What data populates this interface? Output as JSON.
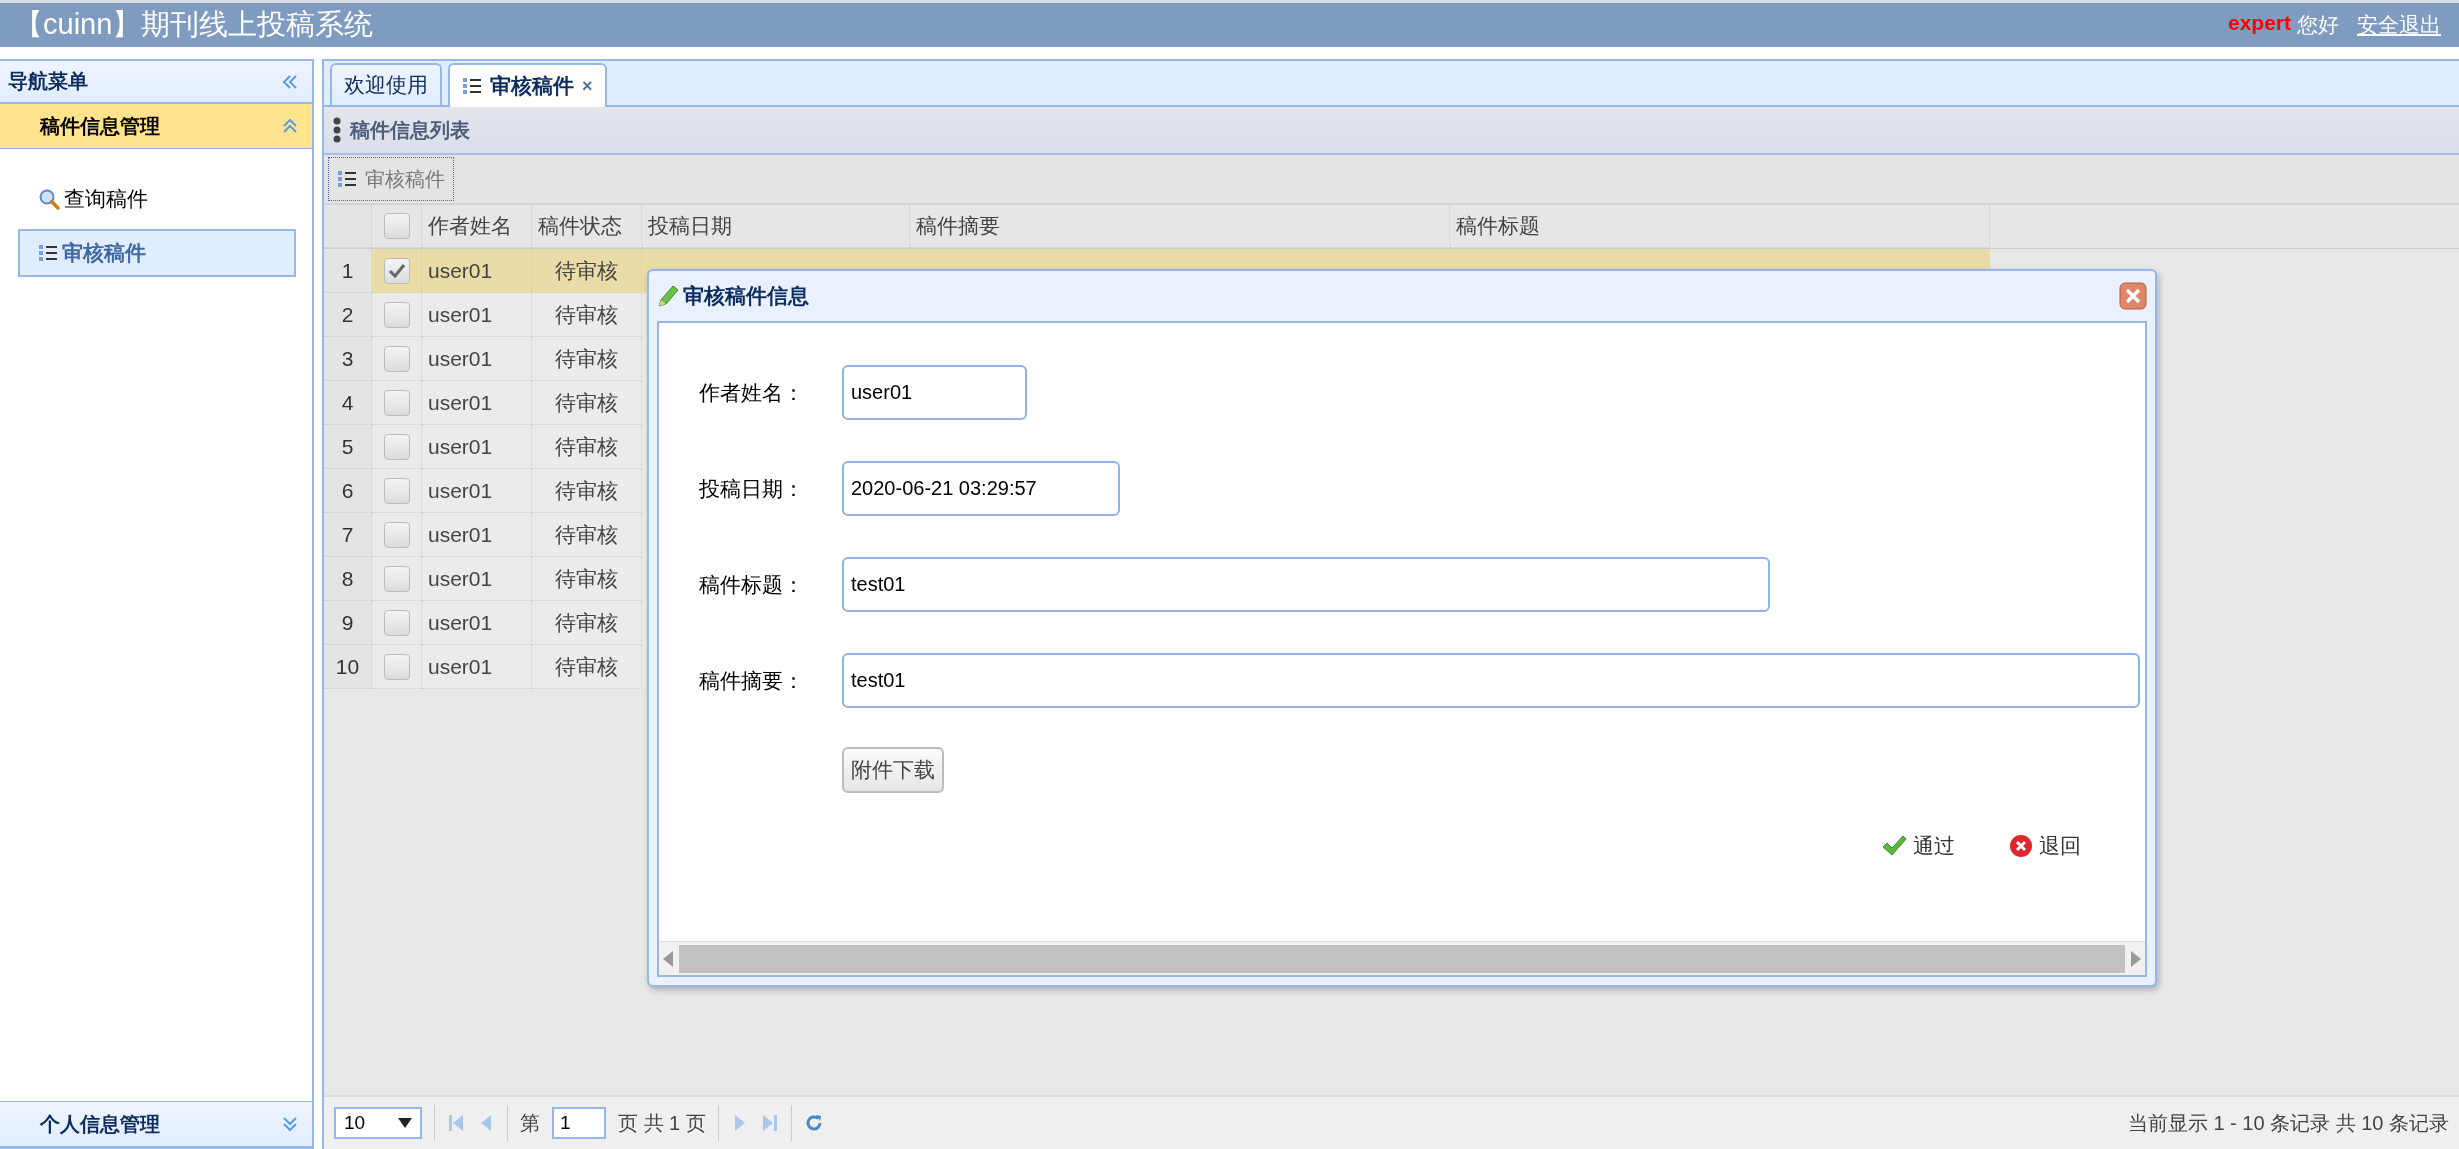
{
  "header": {
    "title": "【cuinn】期刊线上投稿系统",
    "user": "expert",
    "greeting": "您好",
    "logout": "安全退出"
  },
  "sidebar": {
    "title": "导航菜单",
    "sections": [
      {
        "title": "稿件信息管理",
        "expanded": true,
        "items": [
          {
            "label": "查询稿件",
            "selected": false
          },
          {
            "label": "审核稿件",
            "selected": true
          }
        ]
      },
      {
        "title": "个人信息管理",
        "expanded": false
      }
    ]
  },
  "tabs": [
    {
      "label": "欢迎使用",
      "selected": false
    },
    {
      "label": "审核稿件",
      "selected": true,
      "close": "×"
    }
  ],
  "panel": {
    "title": "稿件信息列表",
    "toolbar": [
      {
        "label": "审核稿件"
      }
    ]
  },
  "table": {
    "header_checked": false,
    "columns": [
      "作者姓名",
      "稿件状态",
      "投稿日期",
      "稿件摘要",
      "稿件标题"
    ],
    "rows": [
      {
        "number": "1",
        "checked": true,
        "selected": true,
        "author": "user01",
        "status": "待审核"
      },
      {
        "number": "2",
        "checked": false,
        "selected": false,
        "author": "user01",
        "status": "待审核"
      },
      {
        "number": "3",
        "checked": false,
        "selected": false,
        "author": "user01",
        "status": "待审核"
      },
      {
        "number": "4",
        "checked": false,
        "selected": false,
        "author": "user01",
        "status": "待审核"
      },
      {
        "number": "5",
        "checked": false,
        "selected": false,
        "author": "user01",
        "status": "待审核"
      },
      {
        "number": "6",
        "checked": false,
        "selected": false,
        "author": "user01",
        "status": "待审核"
      },
      {
        "number": "7",
        "checked": false,
        "selected": false,
        "author": "user01",
        "status": "待审核"
      },
      {
        "number": "8",
        "checked": false,
        "selected": false,
        "author": "user01",
        "status": "待审核"
      },
      {
        "number": "9",
        "checked": false,
        "selected": false,
        "author": "user01",
        "status": "待审核"
      },
      {
        "number": "10",
        "checked": false,
        "selected": false,
        "author": "user01",
        "status": "待审核"
      }
    ]
  },
  "pager": {
    "page_size": "10",
    "page_prefix": "第",
    "page": "1",
    "page_suffix": "页 共 1 页",
    "summary": "当前显示 1 - 10 条记录 共 10 条记录"
  },
  "dialog": {
    "title": "审核稿件信息",
    "fields": [
      {
        "label": "作者姓名：",
        "value": "user01"
      },
      {
        "label": "投稿日期：",
        "value": "2020-06-21 03:29:57"
      },
      {
        "label": "稿件标题：",
        "value": "test01"
      },
      {
        "label": "稿件摘要：",
        "value": "test01"
      }
    ],
    "attachment_button": "附件下载",
    "actions": [
      {
        "kind": "approve",
        "label": "通过"
      },
      {
        "kind": "reject",
        "label": "退回"
      }
    ]
  }
}
